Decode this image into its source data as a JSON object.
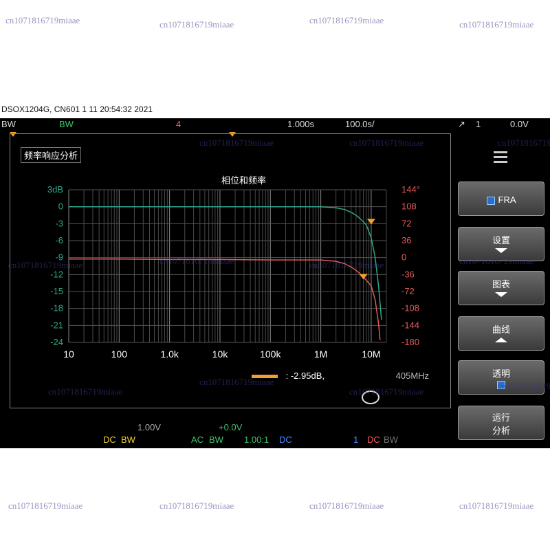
{
  "header": {
    "device_line": "DSOX1204G, CN601 1 11 20:54:32 2021"
  },
  "topbar": {
    "bw_left": "BW",
    "bw_ch2": "BW",
    "ch_num": "4",
    "timebase": "1.000s",
    "sample_rate": "100.0s/",
    "trig_source": "1",
    "trig_level": "0.0V"
  },
  "app": {
    "title": "频率响应分析",
    "plot_title": "相位和频率"
  },
  "chart_data": {
    "type": "line",
    "title": "相位和频率",
    "x_scale": "log",
    "xlim": [
      10,
      20000000
    ],
    "x_tick_labels": [
      "10",
      "100",
      "1.0k",
      "10k",
      "100k",
      "1M",
      "10M"
    ],
    "x_tick_values": [
      10,
      100,
      1000,
      10000,
      100000,
      1000000,
      10000000
    ],
    "y_left_label": "dB",
    "y_left_ticks": [
      "3dB",
      "0",
      "-3",
      "-6",
      "-9",
      "-12",
      "-15",
      "-18",
      "-21",
      "-24"
    ],
    "y_left_values": [
      3,
      0,
      -3,
      -6,
      -9,
      -12,
      -15,
      -18,
      -21,
      -24
    ],
    "ylim_left": [
      -24,
      3
    ],
    "y_right_ticks": [
      "144°",
      "108",
      "72",
      "36",
      "0",
      "-36",
      "-72",
      "-108",
      "-144",
      "-180"
    ],
    "y_right_values": [
      144,
      108,
      72,
      36,
      0,
      -36,
      -72,
      -108,
      -144,
      -180
    ],
    "ylim_right": [
      -180,
      144
    ],
    "series": [
      {
        "axis": "left",
        "color": "#2fa88c",
        "x": [
          10,
          100,
          1000,
          10000,
          100000,
          1000000,
          2000000,
          3000000,
          4000000,
          5000000,
          6000000,
          8000000,
          10000000,
          12000000,
          14000000,
          16000000
        ],
        "y": [
          0,
          0,
          0,
          0,
          0,
          0,
          -0.2,
          -0.5,
          -1,
          -1.5,
          -2.1,
          -3.2,
          -5.5,
          -9,
          -14,
          -20
        ]
      },
      {
        "axis": "right",
        "color": "#e25a5a",
        "x": [
          10,
          100,
          1000,
          10000,
          100000,
          1000000,
          2000000,
          3000000,
          4000000,
          5000000,
          6000000,
          8000000,
          10000000,
          12000000,
          14000000,
          15000000
        ],
        "y": [
          -3,
          -3,
          -4,
          -4,
          -5,
          -5,
          -8,
          -13,
          -20,
          -27,
          -34,
          -48,
          -60,
          -90,
          -140,
          -175
        ]
      }
    ],
    "colors": {
      "gain": "#2fa88c",
      "phase": "#e25a5a",
      "grid": "#555555"
    }
  },
  "cursor_readout": {
    "gain": ": -2.95dB,",
    "freq": "405MHz"
  },
  "softkeys": [
    {
      "label": "FRA"
    },
    {
      "label": "设置"
    },
    {
      "label": "图表"
    },
    {
      "label": "曲线"
    },
    {
      "label": "透明"
    },
    {
      "label_line1": "运行",
      "label_line2": "分析"
    }
  ],
  "statusbar": {
    "ch1_offset": "+0.0V",
    "ch1_coupling": "DC",
    "ch1_bw": "BW",
    "ch2_coupling": "AC",
    "ch2_bw": "BW",
    "ch2_probe": "1.00:1",
    "ch3_coupling": "DC",
    "ch3_probe": "1",
    "ch4_coupling": "DC",
    "ch4_bw": "BW"
  },
  "watermark": "cn1071816719miaae"
}
